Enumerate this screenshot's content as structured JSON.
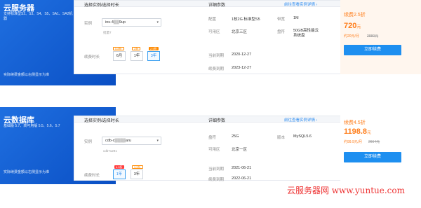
{
  "cards": [
    {
      "product_title": "云服务器",
      "product_desc": "支持标准型S2、S3、S4、S5、SA1、SA2机器",
      "product_note": "实际续费金额以右侧显示为准",
      "left_header": "选择实例/选择时长",
      "mid_header": "详细参数",
      "detail_link": "前往查看实例详情 ›",
      "instance_label": "实例",
      "instance_value": "ins-4▒▒9up",
      "instance_sub": "批量7",
      "duration_label": "续费时长",
      "durations": [
        {
          "label": "6月",
          "discount": "5.8折",
          "discount_style": "light",
          "selected": false
        },
        {
          "label": "1年",
          "discount": "3折",
          "discount_style": "light",
          "selected": false
        },
        {
          "label": "3年",
          "discount": "2.5折",
          "discount_style": "solid",
          "selected": true
        }
      ],
      "specs": [
        {
          "k": "配置",
          "v": "1核2G 标准型S5"
        },
        {
          "k": "带宽",
          "v": "1M"
        },
        {
          "k": "可用区",
          "v": "北京三区"
        },
        {
          "k": "盘符",
          "v": "50GB高性能云系统盘"
        },
        {
          "k": "当前到期",
          "v": "2020-12-27"
        },
        {
          "k": "续费到期",
          "v": "2023-12-27"
        }
      ],
      "price_discount": "续费2.5折",
      "price": "720",
      "price_unit": "元",
      "monthly": "约20元/月",
      "original": "2880元",
      "renew_button": "立即续费"
    },
    {
      "product_title": "云数据库",
      "product_desc": "基础版 5.7、高可用版 5.5、5.6、5.7",
      "product_note": "实际续费金额以右侧显示为准",
      "left_header": "选择实例/选择时长",
      "mid_header": "详细参数",
      "detail_link": "前往查看实例详情 ›",
      "instance_label": "实例",
      "instance_value": "cdb-c▒▒▒▒aru",
      "instance_sub": "cdb71291",
      "duration_label": "续费时长",
      "durations": [
        {
          "label": "1年",
          "discount": "4.5折",
          "discount_style": "solid",
          "selected": true
        },
        {
          "label": "3年",
          "discount": "3.5折",
          "discount_style": "light",
          "selected": false
        }
      ],
      "specs": [
        {
          "k": "盘符",
          "v": "25G"
        },
        {
          "k": "版本",
          "v": "MySQL5.6"
        },
        {
          "k": "可用区",
          "v": "北京一区"
        },
        {
          "k": "当前到期",
          "v": "2021-06-21"
        },
        {
          "k": "续费到期",
          "v": "2022-06-21"
        }
      ],
      "price_discount": "续费4.5折",
      "price": "1198.8",
      "price_unit": "元",
      "monthly": "约99.9元/月",
      "original": "2664元",
      "renew_button": "立即续费"
    }
  ],
  "watermark": "云服务器网 www.yuntue.com"
}
